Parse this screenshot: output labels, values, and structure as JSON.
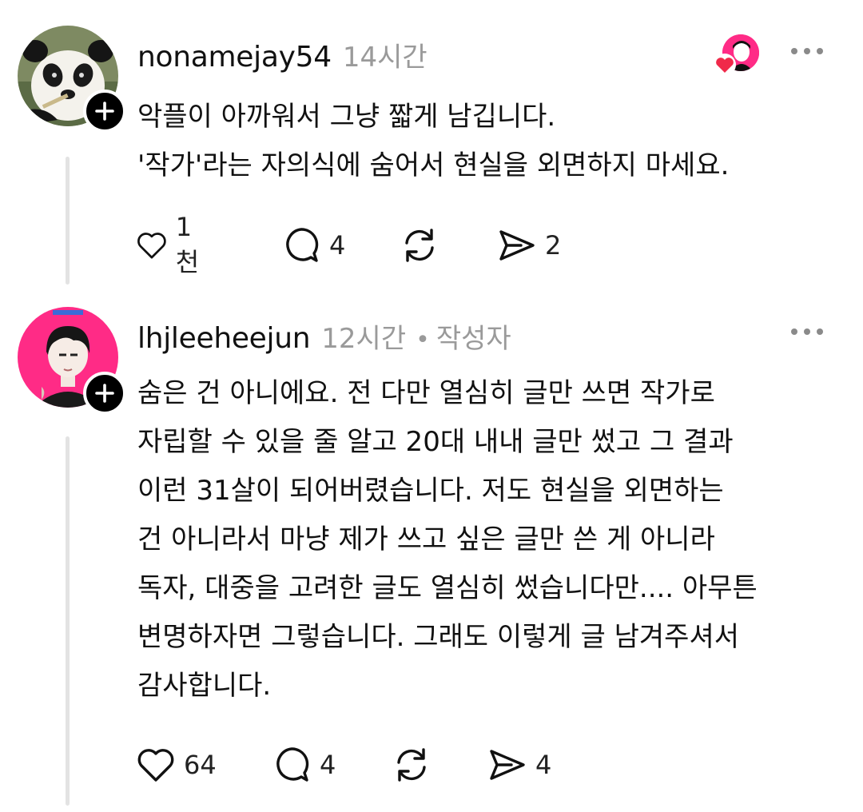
{
  "comments": [
    {
      "username": "nonamejay54",
      "time": "14시간",
      "lines": [
        "악플이 아까워서 그냥 짧게 남깁니다.",
        "'작가'라는 자의식에 숨어서 현실을 외면하지 마세요."
      ],
      "likes": "1천",
      "replies": "4",
      "shares": "2"
    },
    {
      "username": "lhjleeheejun",
      "time": "12시간",
      "author_tag": "작성자",
      "lines": [
        "숨은 건 아니에요. 전 다만 열심히 글만 쓰면 작가로",
        "자립할 수 있을 줄 알고 20대 내내 글만 썼고 그 결과",
        "이런 31살이 되어버렸습니다. 저도 현실을 외면하는",
        "건 아니라서 마냥 제가 쓰고 싶은 글만 쓴 게 아니라",
        "독자, 대중을 고려한 글도 열심히 썼습니다만.... 아무튼",
        "변명하자면 그렇습니다. 그래도 이렇게 글 남겨주셔서",
        "감사합니다."
      ],
      "likes": "64",
      "replies": "4",
      "shares": "4"
    }
  ],
  "icons": [
    "heart-icon",
    "comment-icon",
    "repost-icon",
    "share-icon",
    "more-icon",
    "plus-icon"
  ],
  "colors": {
    "accent_pink": "#ff2b86",
    "heart_red": "#f0294a",
    "muted": "#9a9a9a"
  }
}
